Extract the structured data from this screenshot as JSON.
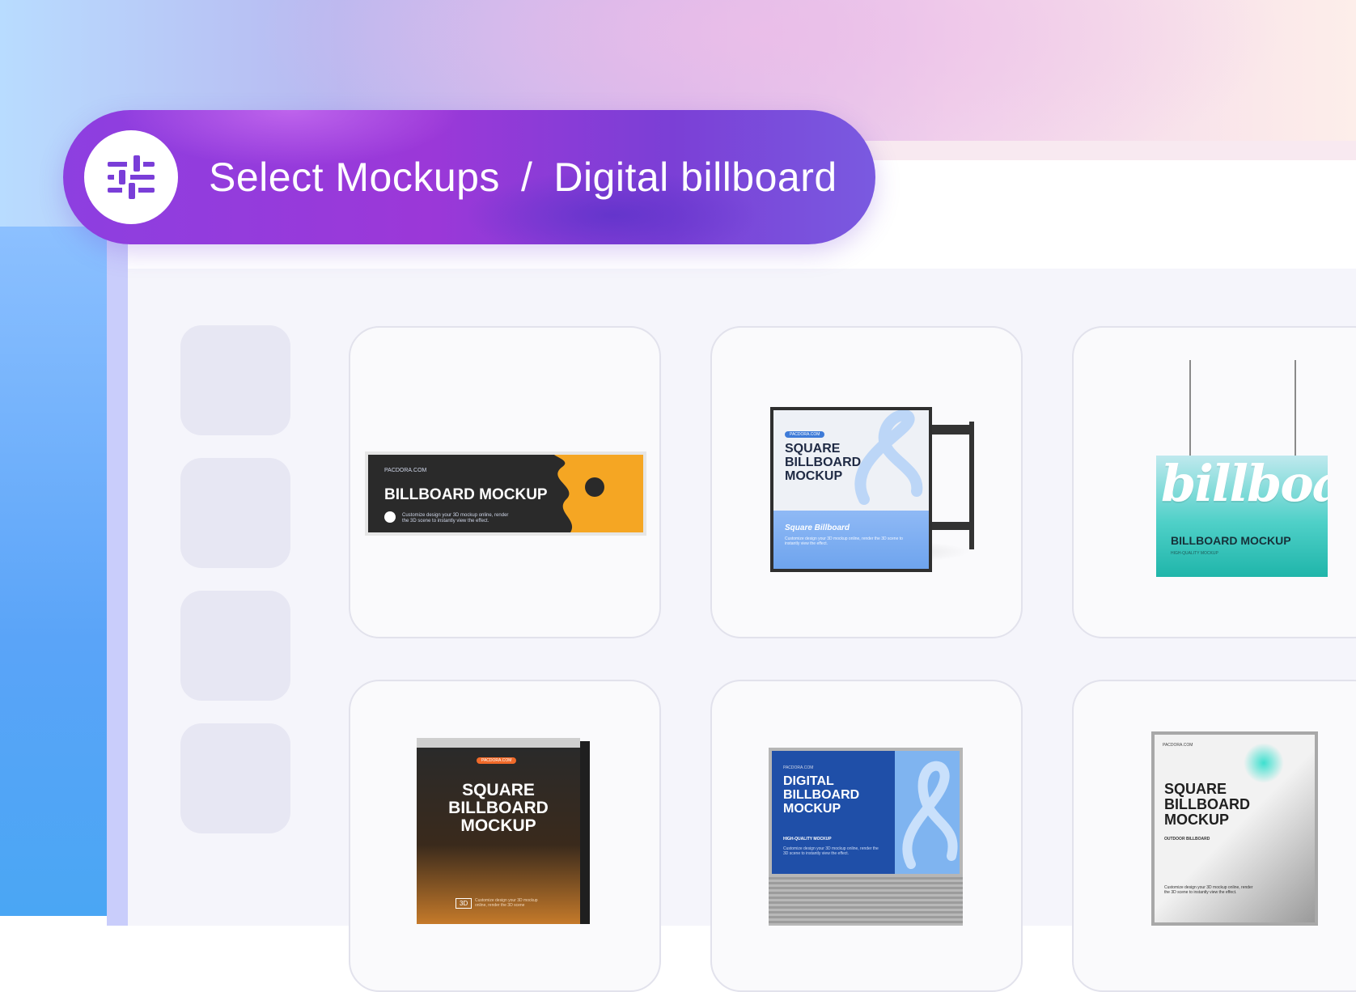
{
  "header": {
    "section": "Select Mockups",
    "separator": "/",
    "category": "Digital billboard",
    "icon": "sliders-icon",
    "accent": "#8d3fe0"
  },
  "cards": [
    {
      "title": "BILLBOARD MOCKUP",
      "brand": "PACDORA.COM",
      "desc": "Customize design your 3D mockup online, render the 3D scene to instantly view the effect."
    },
    {
      "badge": "PACDORA.COM",
      "title": "SQUARE BILLBOARD MOCKUP",
      "subtitle": "Square Billboard",
      "desc": "Customize design your 3D mockup online, render the 3D scene to instantly view the effect."
    },
    {
      "script": "billboard",
      "title": "BILLBOARD MOCKUP",
      "desc": "HIGH-QUALITY MOCKUP"
    },
    {
      "badge": "PACDORA.COM",
      "title": "SQUARE BILLBOARD MOCKUP",
      "tag": "3D",
      "desc": "Customize design your 3D mockup online, render the 3D scene"
    },
    {
      "brand": "PACDORA.COM",
      "title": "DIGITAL BILLBOARD MOCKUP",
      "subtitle": "HIGH-QUALITY MOCKUP",
      "desc": "Customize design your 3D mockup online, render the 3D scene to instantly view the effect."
    },
    {
      "brand": "PACDORA.COM",
      "title": "SQUARE BILLBOARD MOCKUP",
      "subtitle": "OUTDOOR BILLBOARD",
      "desc": "Customize design your 3D mockup online, render the 3D scene to instantly view the effect."
    }
  ]
}
